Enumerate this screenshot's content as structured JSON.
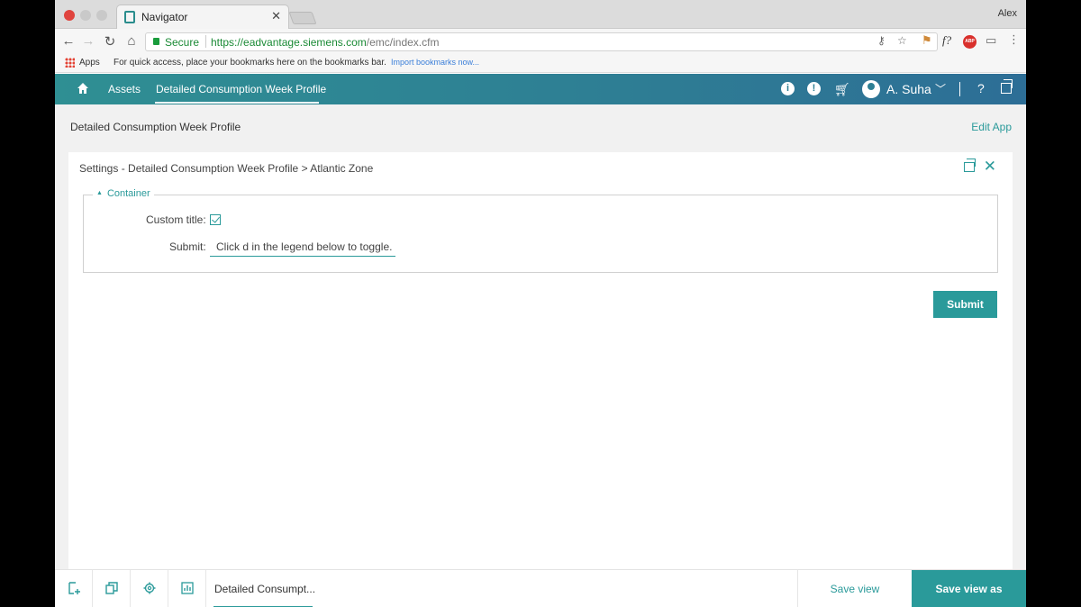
{
  "browser": {
    "tab_title": "Navigator",
    "tab_close": "✕",
    "profile_name": "Alex",
    "secure_label": "Secure",
    "url_host": "https://eadvantage.siemens.com",
    "url_path": "/emc/index.cfm",
    "bookmarks": {
      "apps_label": "Apps",
      "hint": "For quick access, place your bookmarks here on the bookmarks bar.",
      "import_link": "Import bookmarks now..."
    }
  },
  "app_header": {
    "nav_assets": "Assets",
    "nav_active": "Detailed Consumption Week Profile",
    "user_name": "A. Suha",
    "help": "?"
  },
  "page": {
    "title": "Detailed Consumption Week Profile",
    "edit_app": "Edit App"
  },
  "panel": {
    "title": "Settings - Detailed Consumption Week Profile > Atlantic Zone",
    "fieldset_legend": "Container",
    "custom_title_label": "Custom title:",
    "custom_title_checked": true,
    "submit_field_label": "Submit:",
    "submit_field_value": "Click d in the legend below to toggle.",
    "submit_button": "Submit"
  },
  "bottom_bar": {
    "tab_label": "Detailed Consumpt...",
    "save_view": "Save view",
    "save_view_as": "Save view as"
  },
  "colors": {
    "accent": "#2a9a9a",
    "header_gradient_start": "#2f8f93",
    "header_gradient_end": "#2d6e96"
  }
}
